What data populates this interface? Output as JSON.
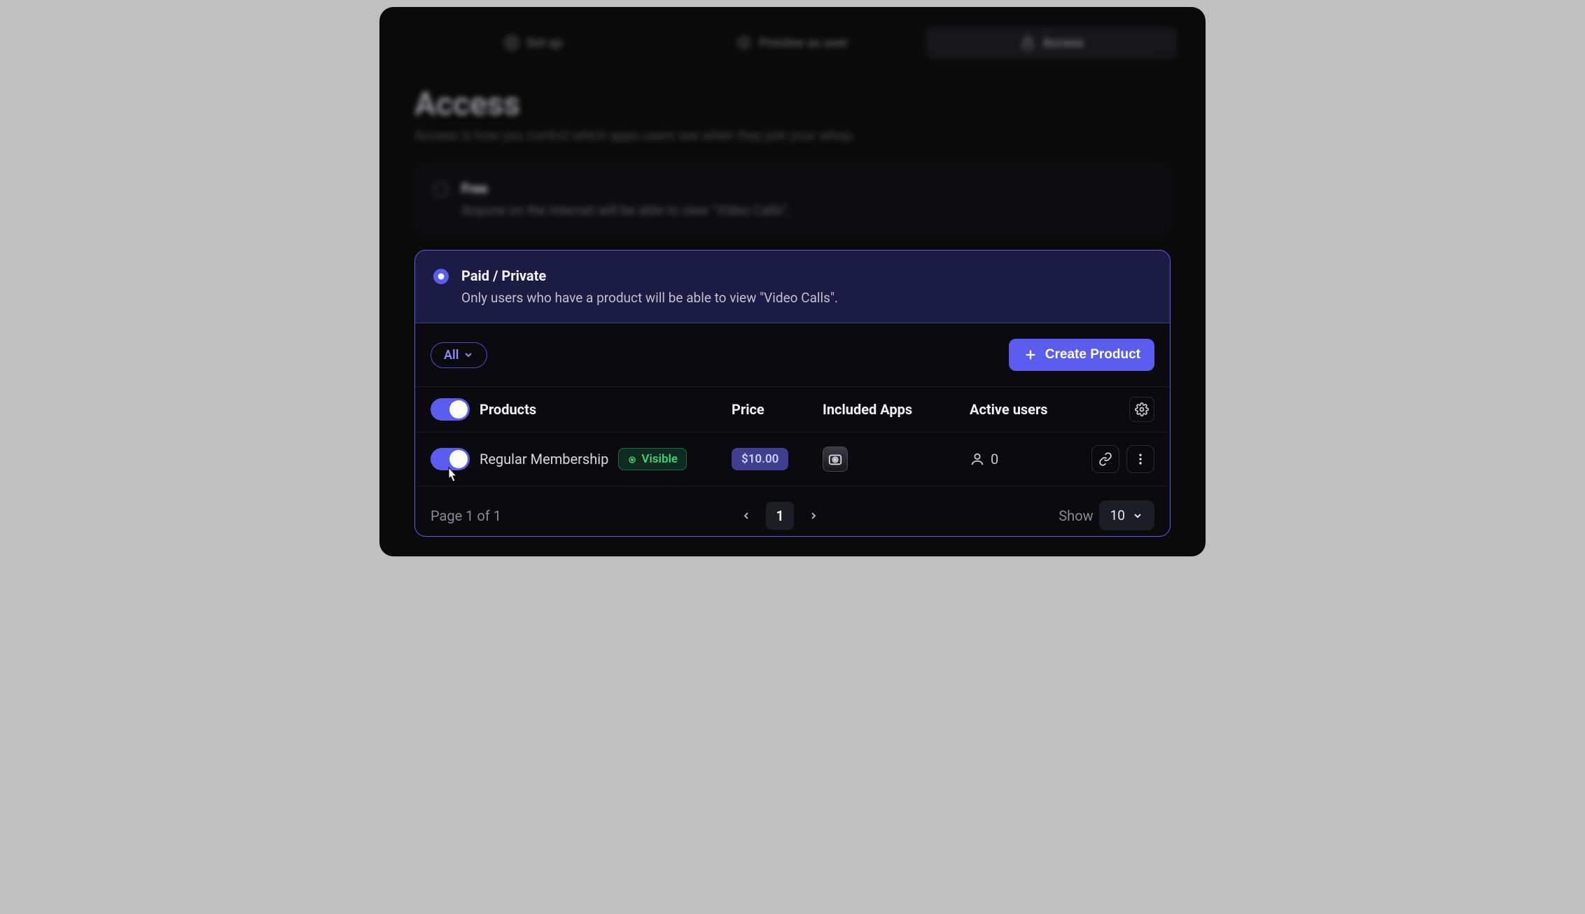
{
  "tabs": [
    {
      "label": "Set up",
      "icon": "gear"
    },
    {
      "label": "Preview as user",
      "icon": "eye-circle"
    },
    {
      "label": "Access",
      "icon": "lock"
    }
  ],
  "active_tab": 2,
  "page": {
    "title": "Access",
    "subtitle": "Access is how you control which apps users see when they join your whop."
  },
  "options": {
    "free": {
      "title": "Free",
      "desc": "Anyone on the internet will be able to view \"Video Calls\"."
    },
    "paid": {
      "title": "Paid / Private",
      "desc": "Only users who have a product will be able to view \"Video Calls\"."
    }
  },
  "filter": {
    "label": "All"
  },
  "create_button": "Create Product",
  "columns": {
    "products": "Products",
    "price": "Price",
    "apps": "Included Apps",
    "users": "Active users"
  },
  "products": [
    {
      "name": "Regular Membership",
      "visibility": "Visible",
      "price": "$10.00",
      "active_users": "0"
    }
  ],
  "pagination": {
    "summary": "Page 1 of 1",
    "current": "1",
    "show_label": "Show",
    "show_value": "10"
  }
}
